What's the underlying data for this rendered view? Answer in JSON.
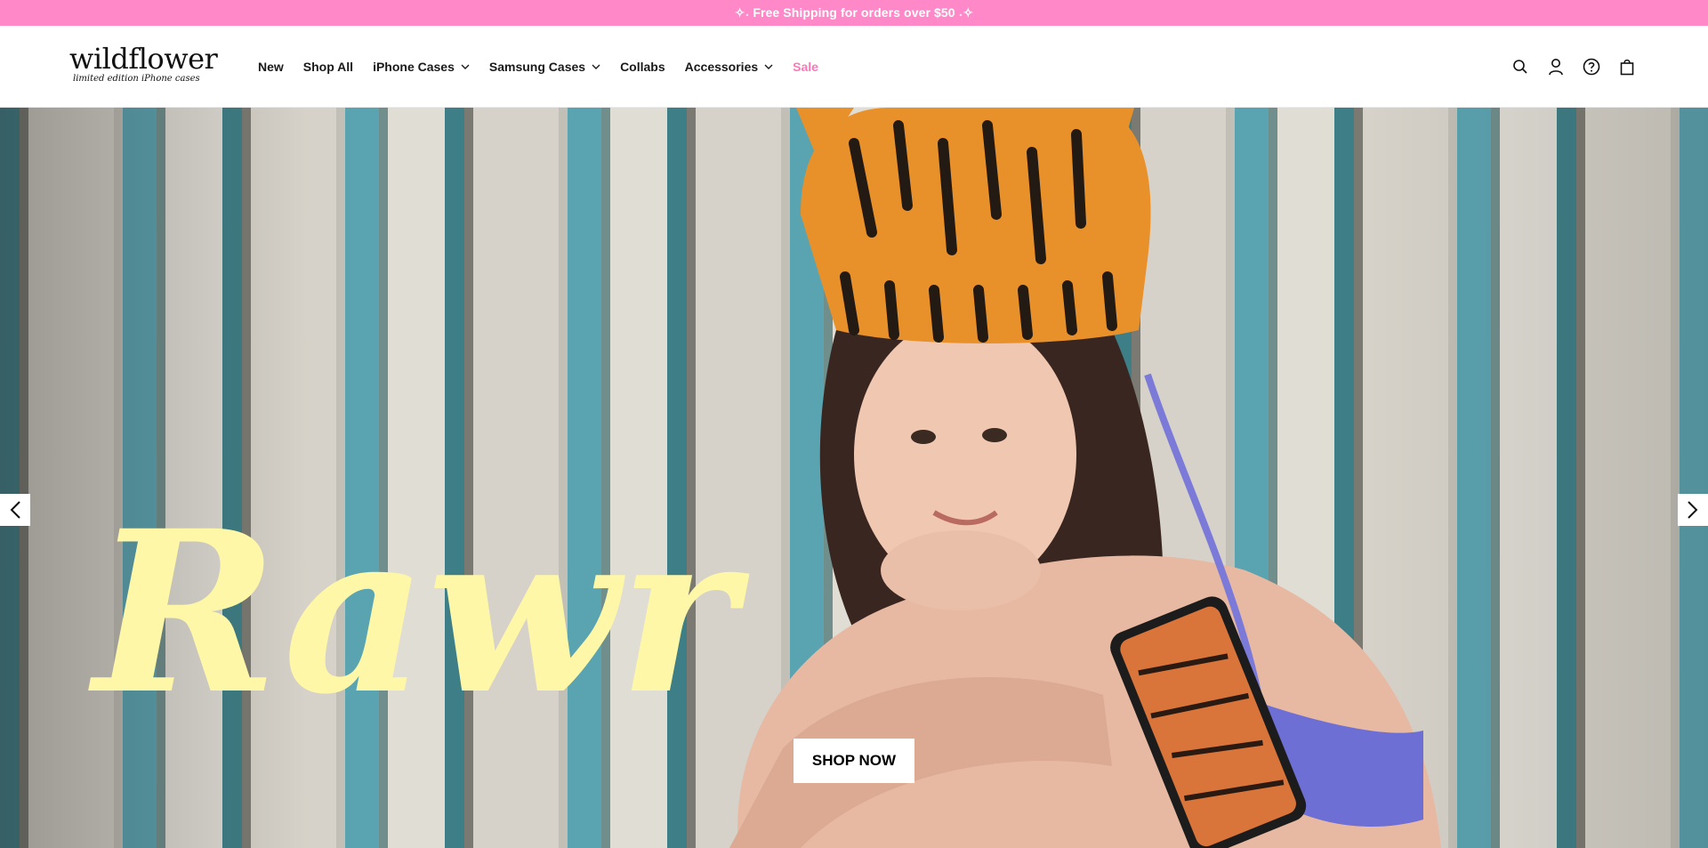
{
  "announcement": {
    "text": "✧˖ Free Shipping for orders over $50 ˖✧"
  },
  "logo": {
    "main": "wildflower",
    "sub": "limited edition iPhone cases"
  },
  "nav": {
    "items": [
      {
        "label": "New",
        "has_dropdown": false
      },
      {
        "label": "Shop All",
        "has_dropdown": false
      },
      {
        "label": "iPhone Cases",
        "has_dropdown": true
      },
      {
        "label": "Samsung Cases",
        "has_dropdown": true
      },
      {
        "label": "Collabs",
        "has_dropdown": false
      },
      {
        "label": "Accessories",
        "has_dropdown": true
      },
      {
        "label": "Sale",
        "has_dropdown": false
      }
    ]
  },
  "header_icons": [
    "search-icon",
    "account-icon",
    "help-icon",
    "cart-icon"
  ],
  "hero": {
    "headline": "Rawr",
    "cta_label": "SHOP NOW",
    "headline_color": "#fef7a8"
  },
  "colors": {
    "announcement_bg": "#ff88c8",
    "sale": "#ff77b8"
  }
}
